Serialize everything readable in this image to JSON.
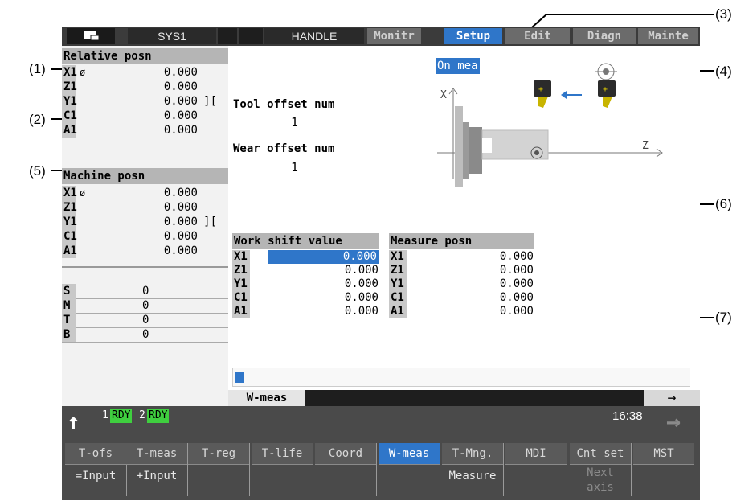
{
  "callouts": [
    "(1)",
    "(2)",
    "(3)",
    "(4)",
    "(5)",
    "(6)",
    "(7)"
  ],
  "topbar": {
    "system": "SYS1",
    "mode": "HANDLE",
    "tabs": [
      "Monitr",
      "Setup",
      "Edit",
      "Diagn",
      "Mainte"
    ],
    "active_tab": "Setup"
  },
  "relative": {
    "title": "Relative posn",
    "rows": [
      {
        "axis": "X1",
        "sub": "ø",
        "value": "0.000",
        "extra": ""
      },
      {
        "axis": "Z1",
        "sub": "",
        "value": "0.000",
        "extra": ""
      },
      {
        "axis": "Y1",
        "sub": "",
        "value": "0.000",
        "extra": "]["
      },
      {
        "axis": "C1",
        "sub": "",
        "value": "0.000",
        "extra": ""
      },
      {
        "axis": "A1",
        "sub": "",
        "value": "0.000",
        "extra": ""
      }
    ]
  },
  "machine": {
    "title": "Machine posn",
    "rows": [
      {
        "axis": "X1",
        "sub": "ø",
        "value": "0.000",
        "extra": ""
      },
      {
        "axis": "Z1",
        "sub": "",
        "value": "0.000",
        "extra": ""
      },
      {
        "axis": "Y1",
        "sub": "",
        "value": "0.000",
        "extra": "]["
      },
      {
        "axis": "C1",
        "sub": "",
        "value": "0.000",
        "extra": ""
      },
      {
        "axis": "A1",
        "sub": "",
        "value": "0.000",
        "extra": ""
      }
    ]
  },
  "smtb": [
    {
      "axis": "S",
      "value": "0"
    },
    {
      "axis": "M",
      "value": "0"
    },
    {
      "axis": "T",
      "value": "0"
    },
    {
      "axis": "B",
      "value": "0"
    }
  ],
  "main": {
    "status_badge": "On mea",
    "tool_offset_label": "Tool offset num",
    "tool_offset_value": "1",
    "wear_offset_label": "Wear offset num",
    "wear_offset_value": "1",
    "diagram_x": "X",
    "diagram_z": "Z",
    "work_shift": {
      "title": "Work shift value",
      "rows": [
        {
          "axis": "X1",
          "value": "0.000"
        },
        {
          "axis": "Z1",
          "value": "0.000"
        },
        {
          "axis": "Y1",
          "value": "0.000"
        },
        {
          "axis": "C1",
          "value": "0.000"
        },
        {
          "axis": "A1",
          "value": "0.000"
        }
      ]
    },
    "measure": {
      "title": "Measure posn",
      "rows": [
        {
          "axis": "X1",
          "value": "0.000"
        },
        {
          "axis": "Z1",
          "value": "0.000"
        },
        {
          "axis": "Y1",
          "value": "0.000"
        },
        {
          "axis": "C1",
          "value": "0.000"
        },
        {
          "axis": "A1",
          "value": "0.000"
        }
      ]
    },
    "screen_name": "W-meas",
    "page_arrow": "→"
  },
  "status": {
    "rdy1_num": "1",
    "rdy1": "RDY",
    "rdy2_num": "2",
    "rdy2": "RDY",
    "time": "16:38",
    "up_arrow": "↑",
    "right_arrow": "→"
  },
  "fkeys": [
    {
      "top": "T-ofs",
      "bottom": "=Input"
    },
    {
      "top": "T-meas",
      "bottom": "+Input"
    },
    {
      "top": "T-reg",
      "bottom": ""
    },
    {
      "top": "T-life",
      "bottom": ""
    },
    {
      "top": "Coord",
      "bottom": ""
    },
    {
      "top": "W-meas",
      "bottom": ""
    },
    {
      "top": "T-Mng.",
      "bottom": "Measure"
    },
    {
      "top": "MDI",
      "bottom": ""
    },
    {
      "top": "Cnt set",
      "bottom": "Next\naxis"
    },
    {
      "top": "MST",
      "bottom": ""
    }
  ],
  "colors": {
    "active_blue": "#2f76c9",
    "rdy_green": "#3fcf3f",
    "panel_gray": "#b5b5b5",
    "key_gray": "#4a4a4a"
  },
  "input_progress": 0.02
}
